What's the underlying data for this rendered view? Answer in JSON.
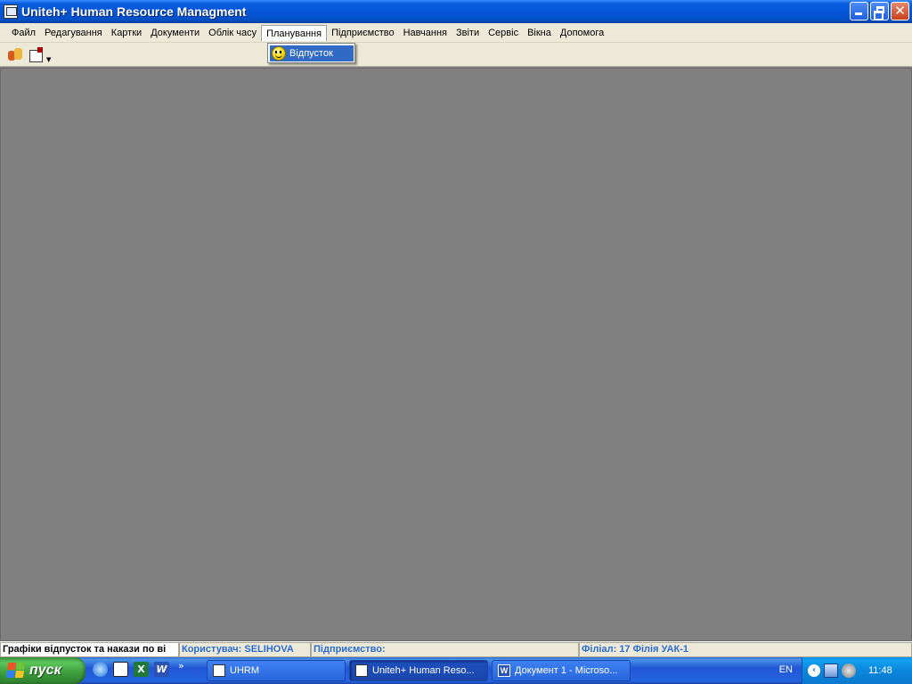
{
  "window": {
    "title": "Uniteh+ Human Resource Managment"
  },
  "menubar": {
    "items": [
      {
        "label": "Файл"
      },
      {
        "label": "Редагування"
      },
      {
        "label": "Картки"
      },
      {
        "label": "Документи"
      },
      {
        "label": "Облік часу"
      },
      {
        "label": "Планування",
        "active": true
      },
      {
        "label": "Підприємство"
      },
      {
        "label": "Навчання"
      },
      {
        "label": "Звіти"
      },
      {
        "label": "Сервіс"
      },
      {
        "label": "Вікна"
      },
      {
        "label": "Допомога"
      }
    ]
  },
  "dropdown": {
    "items": [
      {
        "label": "Відпусток",
        "icon": "smiley-icon",
        "highlighted": true
      }
    ]
  },
  "statusbar": {
    "message": "Графіки відпусток та накази по ві",
    "user": "Користувач: SELIHOVA",
    "enterprise": "Підприємство:",
    "branch": "Філіал: 17 Філія УАК-1"
  },
  "taskbar": {
    "start_label": "пуск",
    "tasks": [
      {
        "label": "UHRM"
      },
      {
        "label": "Uniteh+ Human Reso...",
        "active": true
      },
      {
        "label": "Документ 1 - Microso..."
      }
    ],
    "tray": {
      "language": "EN",
      "time": "11:48"
    }
  },
  "colors": {
    "titlebar": "#0454d8",
    "menu_highlight": "#316ac5",
    "client_bg": "#808080",
    "status_text": "#2c6cd2",
    "taskbar": "#2157d7",
    "start": "#3a9b3a"
  }
}
